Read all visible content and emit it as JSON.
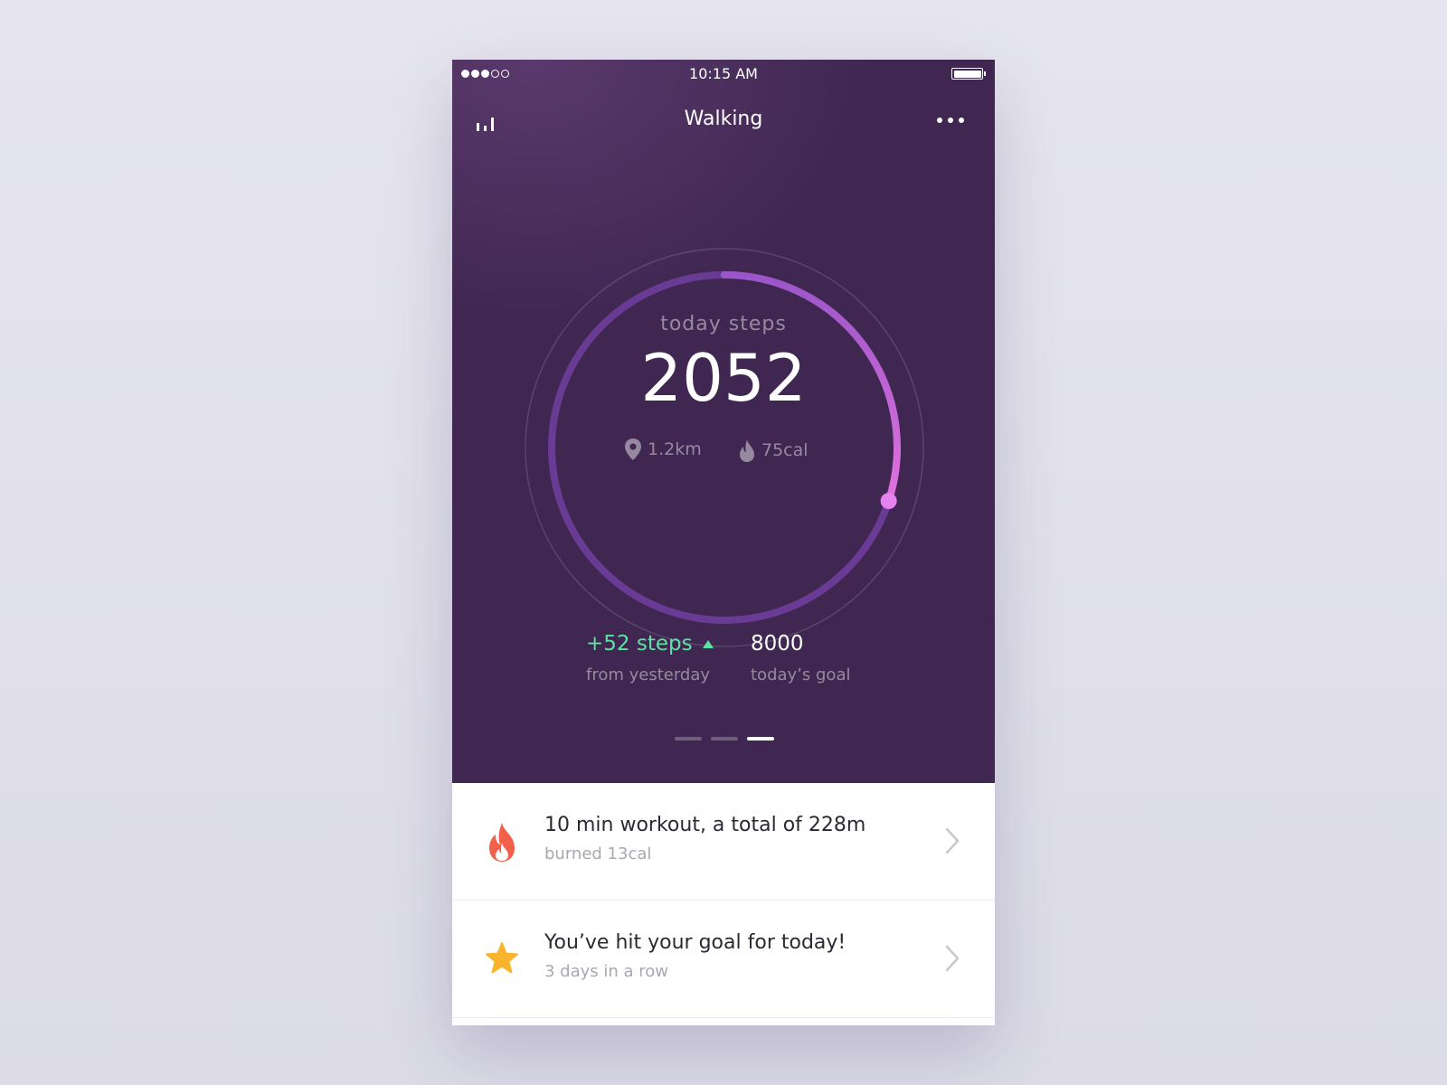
{
  "status_bar": {
    "time": "10:15 AM",
    "signal_bars_filled": 3,
    "signal_bars_total": 5,
    "battery_level": 1.0
  },
  "nav": {
    "title": "Walking",
    "left_icon": "bar-chart-icon",
    "right_icon": "more-icon"
  },
  "steps": {
    "label": "today steps",
    "value": "2052",
    "progress_fraction": 0.3,
    "distance": "1.2km",
    "calories": "75cal"
  },
  "summary": {
    "delta": "+52 steps",
    "delta_caption": "from yesterday",
    "goal": "8000",
    "goal_caption": "today’s goal"
  },
  "pager": {
    "pages": 3,
    "active": 3
  },
  "activities": [
    {
      "icon": "flame-icon",
      "title": "10 min workout, a total of 228m",
      "subtitle": "burned 13cal"
    },
    {
      "icon": "star-icon",
      "title": "You’ve hit your goal for today!",
      "subtitle": "3 days in a row"
    }
  ],
  "colors": {
    "hero_background": "#3f2751",
    "ring_track": "#6a3b94",
    "ring_progress": "#d76be0",
    "delta_green": "#5de2a4",
    "flame": "#f2604b",
    "star": "#f9b42d"
  }
}
